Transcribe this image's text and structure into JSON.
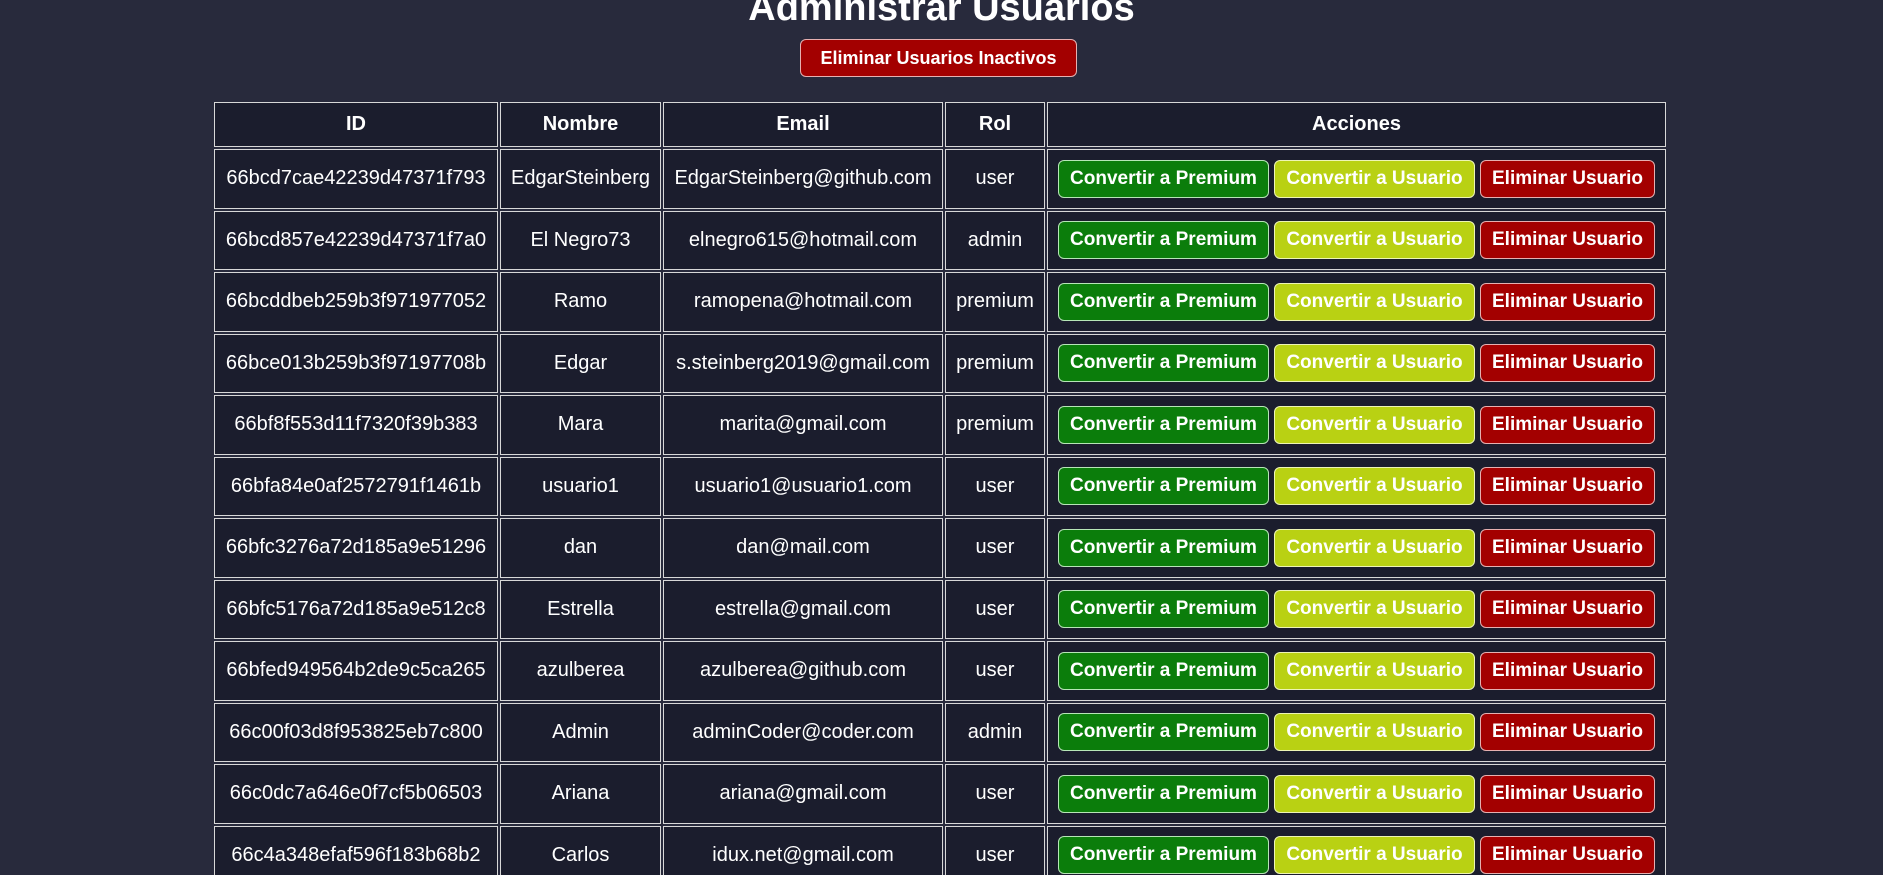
{
  "page": {
    "title": "Administrar Usuarios",
    "bulk_delete_label": "Eliminar Usuarios Inactivos"
  },
  "table": {
    "headers": [
      "ID",
      "Nombre",
      "Email",
      "Rol",
      "Acciones"
    ],
    "actions": {
      "premium_label": "Convertir a Premium",
      "usuario_label": "Convertir a Usuario",
      "delete_label": "Eliminar Usuario"
    },
    "rows": [
      {
        "id": "66bcd7cae42239d47371f793",
        "nombre": "EdgarSteinberg",
        "email": "EdgarSteinberg@github.com",
        "rol": "user"
      },
      {
        "id": "66bcd857e42239d47371f7a0",
        "nombre": "El Negro73",
        "email": "elnegro615@hotmail.com",
        "rol": "admin"
      },
      {
        "id": "66bcddbeb259b3f971977052",
        "nombre": "Ramo",
        "email": "ramopena@hotmail.com",
        "rol": "premium"
      },
      {
        "id": "66bce013b259b3f97197708b",
        "nombre": "Edgar",
        "email": "s.steinberg2019@gmail.com",
        "rol": "premium"
      },
      {
        "id": "66bf8f553d11f7320f39b383",
        "nombre": "Mara",
        "email": "marita@gmail.com",
        "rol": "premium"
      },
      {
        "id": "66bfa84e0af2572791f1461b",
        "nombre": "usuario1",
        "email": "usuario1@usuario1.com",
        "rol": "user"
      },
      {
        "id": "66bfc3276a72d185a9e51296",
        "nombre": "dan",
        "email": "dan@mail.com",
        "rol": "user"
      },
      {
        "id": "66bfc5176a72d185a9e512c8",
        "nombre": "Estrella",
        "email": "estrella@gmail.com",
        "rol": "user"
      },
      {
        "id": "66bfed949564b2de9c5ca265",
        "nombre": "azulberea",
        "email": "azulberea@github.com",
        "rol": "user"
      },
      {
        "id": "66c00f03d8f953825eb7c800",
        "nombre": "Admin",
        "email": "adminCoder@coder.com",
        "rol": "admin"
      },
      {
        "id": "66c0dc7a646e0f7cf5b06503",
        "nombre": "Ariana",
        "email": "ariana@gmail.com",
        "rol": "user"
      },
      {
        "id": "66c4a348efaf596f183b68b2",
        "nombre": "Carlos",
        "email": "idux.net@gmail.com",
        "rol": "user"
      }
    ]
  },
  "colors": {
    "background": "#282a3c",
    "cell_background": "#1b1d2d",
    "premium_button": "#0b7d0b",
    "usuario_button": "#b9d113",
    "delete_button": "#a30000"
  }
}
